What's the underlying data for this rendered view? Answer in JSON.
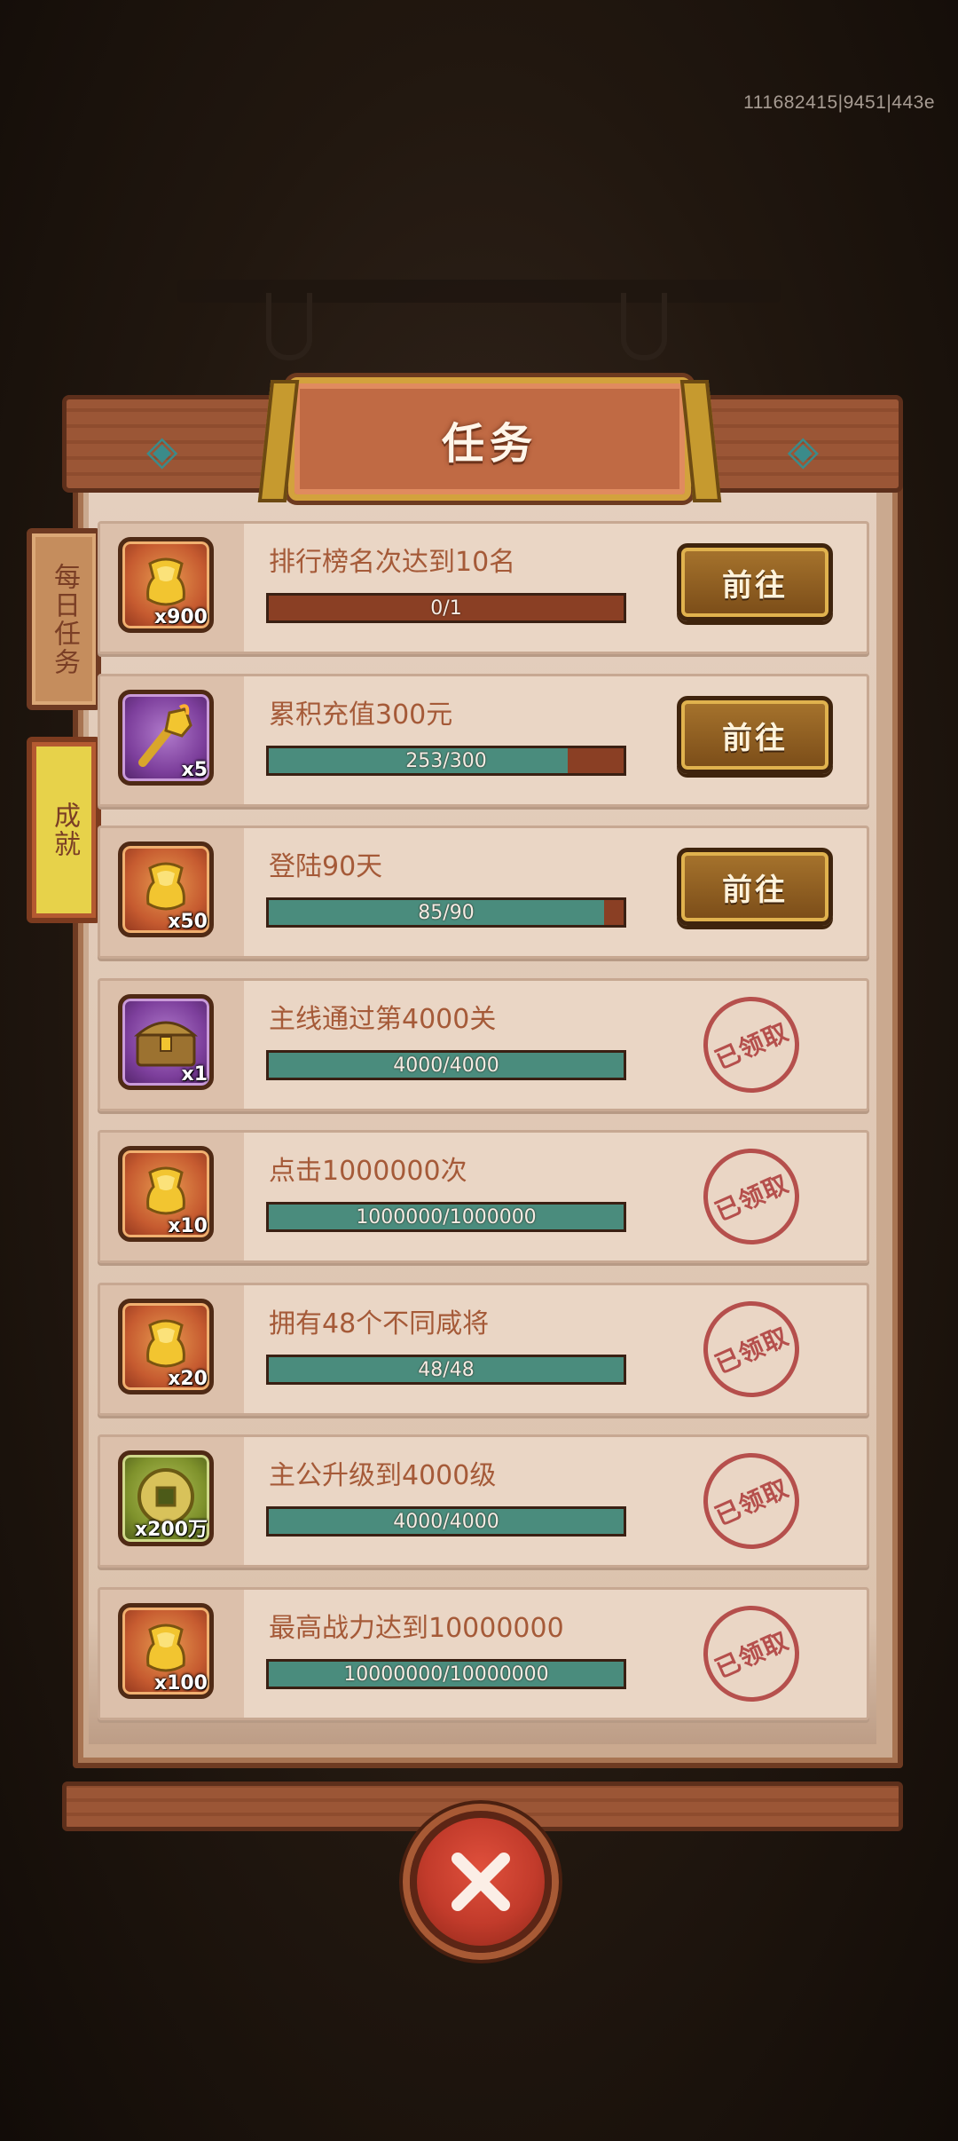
{
  "build_id": "111682415|9451|443e",
  "title": "任务",
  "side_tabs": [
    {
      "label": "每日任务"
    },
    {
      "label": "成就"
    }
  ],
  "tasks": [
    {
      "title": "排行榜名次达到10名",
      "qty": "x900",
      "icon": "gold-ingot-icon",
      "tile": "orange",
      "progress_text": "0/1",
      "progress": 0.0,
      "status": "go",
      "button_label": "前往"
    },
    {
      "title": "累积充值300元",
      "qty": "x5",
      "icon": "golden-scepter-icon",
      "tile": "purple",
      "progress_text": "253/300",
      "progress": 0.843,
      "status": "go",
      "button_label": "前往"
    },
    {
      "title": "登陆90天",
      "qty": "x50",
      "icon": "gold-ingot-icon",
      "tile": "orange",
      "progress_text": "85/90",
      "progress": 0.944,
      "status": "go",
      "button_label": "前往"
    },
    {
      "title": "主线通过第4000关",
      "qty": "x1",
      "icon": "treasure-chest-icon",
      "tile": "purple",
      "progress_text": "4000/4000",
      "progress": 1.0,
      "status": "claimed",
      "stamp_label": "已领取"
    },
    {
      "title": "点击1000000次",
      "qty": "x10",
      "icon": "gold-ingot-icon",
      "tile": "orange",
      "progress_text": "1000000/1000000",
      "progress": 1.0,
      "status": "claimed",
      "stamp_label": "已领取"
    },
    {
      "title": "拥有48个不同咸将",
      "qty": "x20",
      "icon": "gold-ingot-icon",
      "tile": "orange",
      "progress_text": "48/48",
      "progress": 1.0,
      "status": "claimed",
      "stamp_label": "已领取"
    },
    {
      "title": "主公升级到4000级",
      "qty": "x200万",
      "icon": "copper-coin-icon",
      "tile": "green",
      "progress_text": "4000/4000",
      "progress": 1.0,
      "status": "claimed",
      "stamp_label": "已领取"
    },
    {
      "title": "最高战力达到10000000",
      "qty": "x100",
      "icon": "gold-ingot-icon",
      "tile": "orange",
      "progress_text": "10000000/10000000",
      "progress": 1.0,
      "status": "claimed",
      "stamp_label": "已领取"
    }
  ],
  "colors": {
    "progress_fill": "#4a8c7d",
    "progress_empty": "#8a3f24",
    "title_plate": "#c06a44",
    "stamp": "#b0413f"
  }
}
